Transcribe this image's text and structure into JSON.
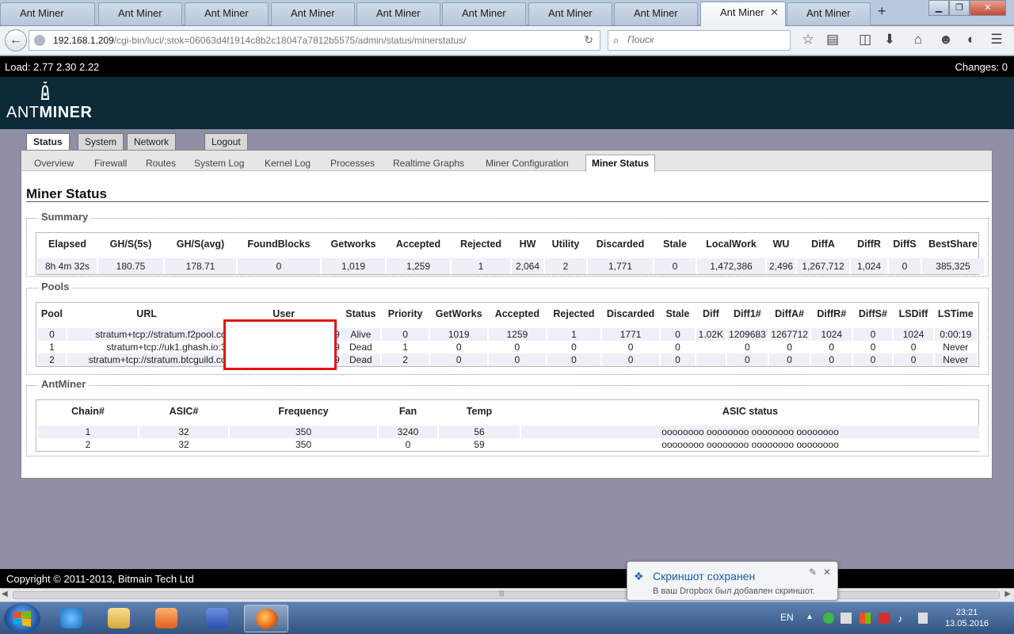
{
  "browser": {
    "tabs": [
      {
        "label": "Ant Miner",
        "active": false
      },
      {
        "label": "Ant Miner",
        "active": false
      },
      {
        "label": "Ant Miner",
        "active": false
      },
      {
        "label": "Ant Miner",
        "active": false
      },
      {
        "label": "Ant Miner",
        "active": false
      },
      {
        "label": "Ant Miner",
        "active": false
      },
      {
        "label": "Ant Miner",
        "active": false
      },
      {
        "label": "Ant Miner",
        "active": false
      },
      {
        "label": "Ant Miner",
        "active": true
      },
      {
        "label": "Ant Miner",
        "active": false
      }
    ],
    "new_tab_icon": "plus-icon",
    "url_host": "192.168.1.209",
    "url_path": "/cgi-bin/luci/;stok=06063d4f1914c8b2c18047a7812b5575/admin/status/minerstatus/",
    "search_placeholder": "Поиск"
  },
  "header": {
    "load": "Load: 2.77 2.30 2.22",
    "changes": "Changes: 0",
    "logo_ant": "ANT",
    "logo_miner": "MINER"
  },
  "primary_tabs": [
    "Status",
    "System",
    "Network",
    "Logout"
  ],
  "sub_tabs": [
    "Overview",
    "Firewall",
    "Routes",
    "System Log",
    "Kernel Log",
    "Processes",
    "Realtime Graphs",
    "Miner Configuration",
    "Miner Status"
  ],
  "page_title": "Miner Status",
  "summary": {
    "legend": "Summary",
    "headers": [
      "Elapsed",
      "GH/S(5s)",
      "GH/S(avg)",
      "FoundBlocks",
      "Getworks",
      "Accepted",
      "Rejected",
      "HW",
      "Utility",
      "Discarded",
      "Stale",
      "LocalWork",
      "WU",
      "DiffA",
      "DiffR",
      "DiffS",
      "BestShare"
    ],
    "values": [
      "8h 4m 32s",
      "180.75",
      "178.71",
      "0",
      "1,019",
      "1,259",
      "1",
      "2,064",
      "2",
      "1,771",
      "0",
      "1,472,386",
      "2,496",
      "1,267,712",
      "1,024",
      "0",
      "385,325"
    ]
  },
  "pools": {
    "legend": "Pools",
    "headers": [
      "Pool",
      "URL",
      "User",
      "Status",
      "Priority",
      "GetWorks",
      "Accepted",
      "Rejected",
      "Discarded",
      "Stale",
      "Diff",
      "Diff1#",
      "DiffA#",
      "DiffR#",
      "DiffS#",
      "LSDiff",
      "LSTime"
    ],
    "rows": [
      [
        "0",
        "stratum+tcp://stratum.f2pool.co",
        "ant9",
        "Alive",
        "0",
        "1019",
        "1259",
        "1",
        "1771",
        "0",
        "1.02K",
        "1209683",
        "1267712",
        "1024",
        "0",
        "1024",
        "0:00:19"
      ],
      [
        "1",
        "stratum+tcp://uk1.ghash.io:3",
        "ant9",
        "Dead",
        "1",
        "0",
        "0",
        "0",
        "0",
        "0",
        "",
        "0",
        "0",
        "0",
        "0",
        "0",
        "Never"
      ],
      [
        "2",
        "stratum+tcp://stratum.btcguild.co",
        "ant9",
        "Dead",
        "2",
        "0",
        "0",
        "0",
        "0",
        "0",
        "",
        "0",
        "0",
        "0",
        "0",
        "0",
        "Never"
      ]
    ]
  },
  "antminer": {
    "legend": "AntMiner",
    "headers": [
      "Chain#",
      "ASIC#",
      "Frequency",
      "Fan",
      "Temp",
      "ASIC status"
    ],
    "rows": [
      [
        "1",
        "32",
        "350",
        "3240",
        "56",
        "oooooooo oooooooo oooooooo oooooooo"
      ],
      [
        "2",
        "32",
        "350",
        "0",
        "59",
        "oooooooo oooooooo oooooooo oooooooo"
      ]
    ]
  },
  "footer": "Copyright © 2011-2013, Bitmain Tech Ltd",
  "notification": {
    "title": "Скриншот сохранен",
    "body": "В ваш Dropbox был добавлен скриншот."
  },
  "taskbar": {
    "lang": "EN",
    "time": "23:21",
    "date": "13.05.2016"
  }
}
